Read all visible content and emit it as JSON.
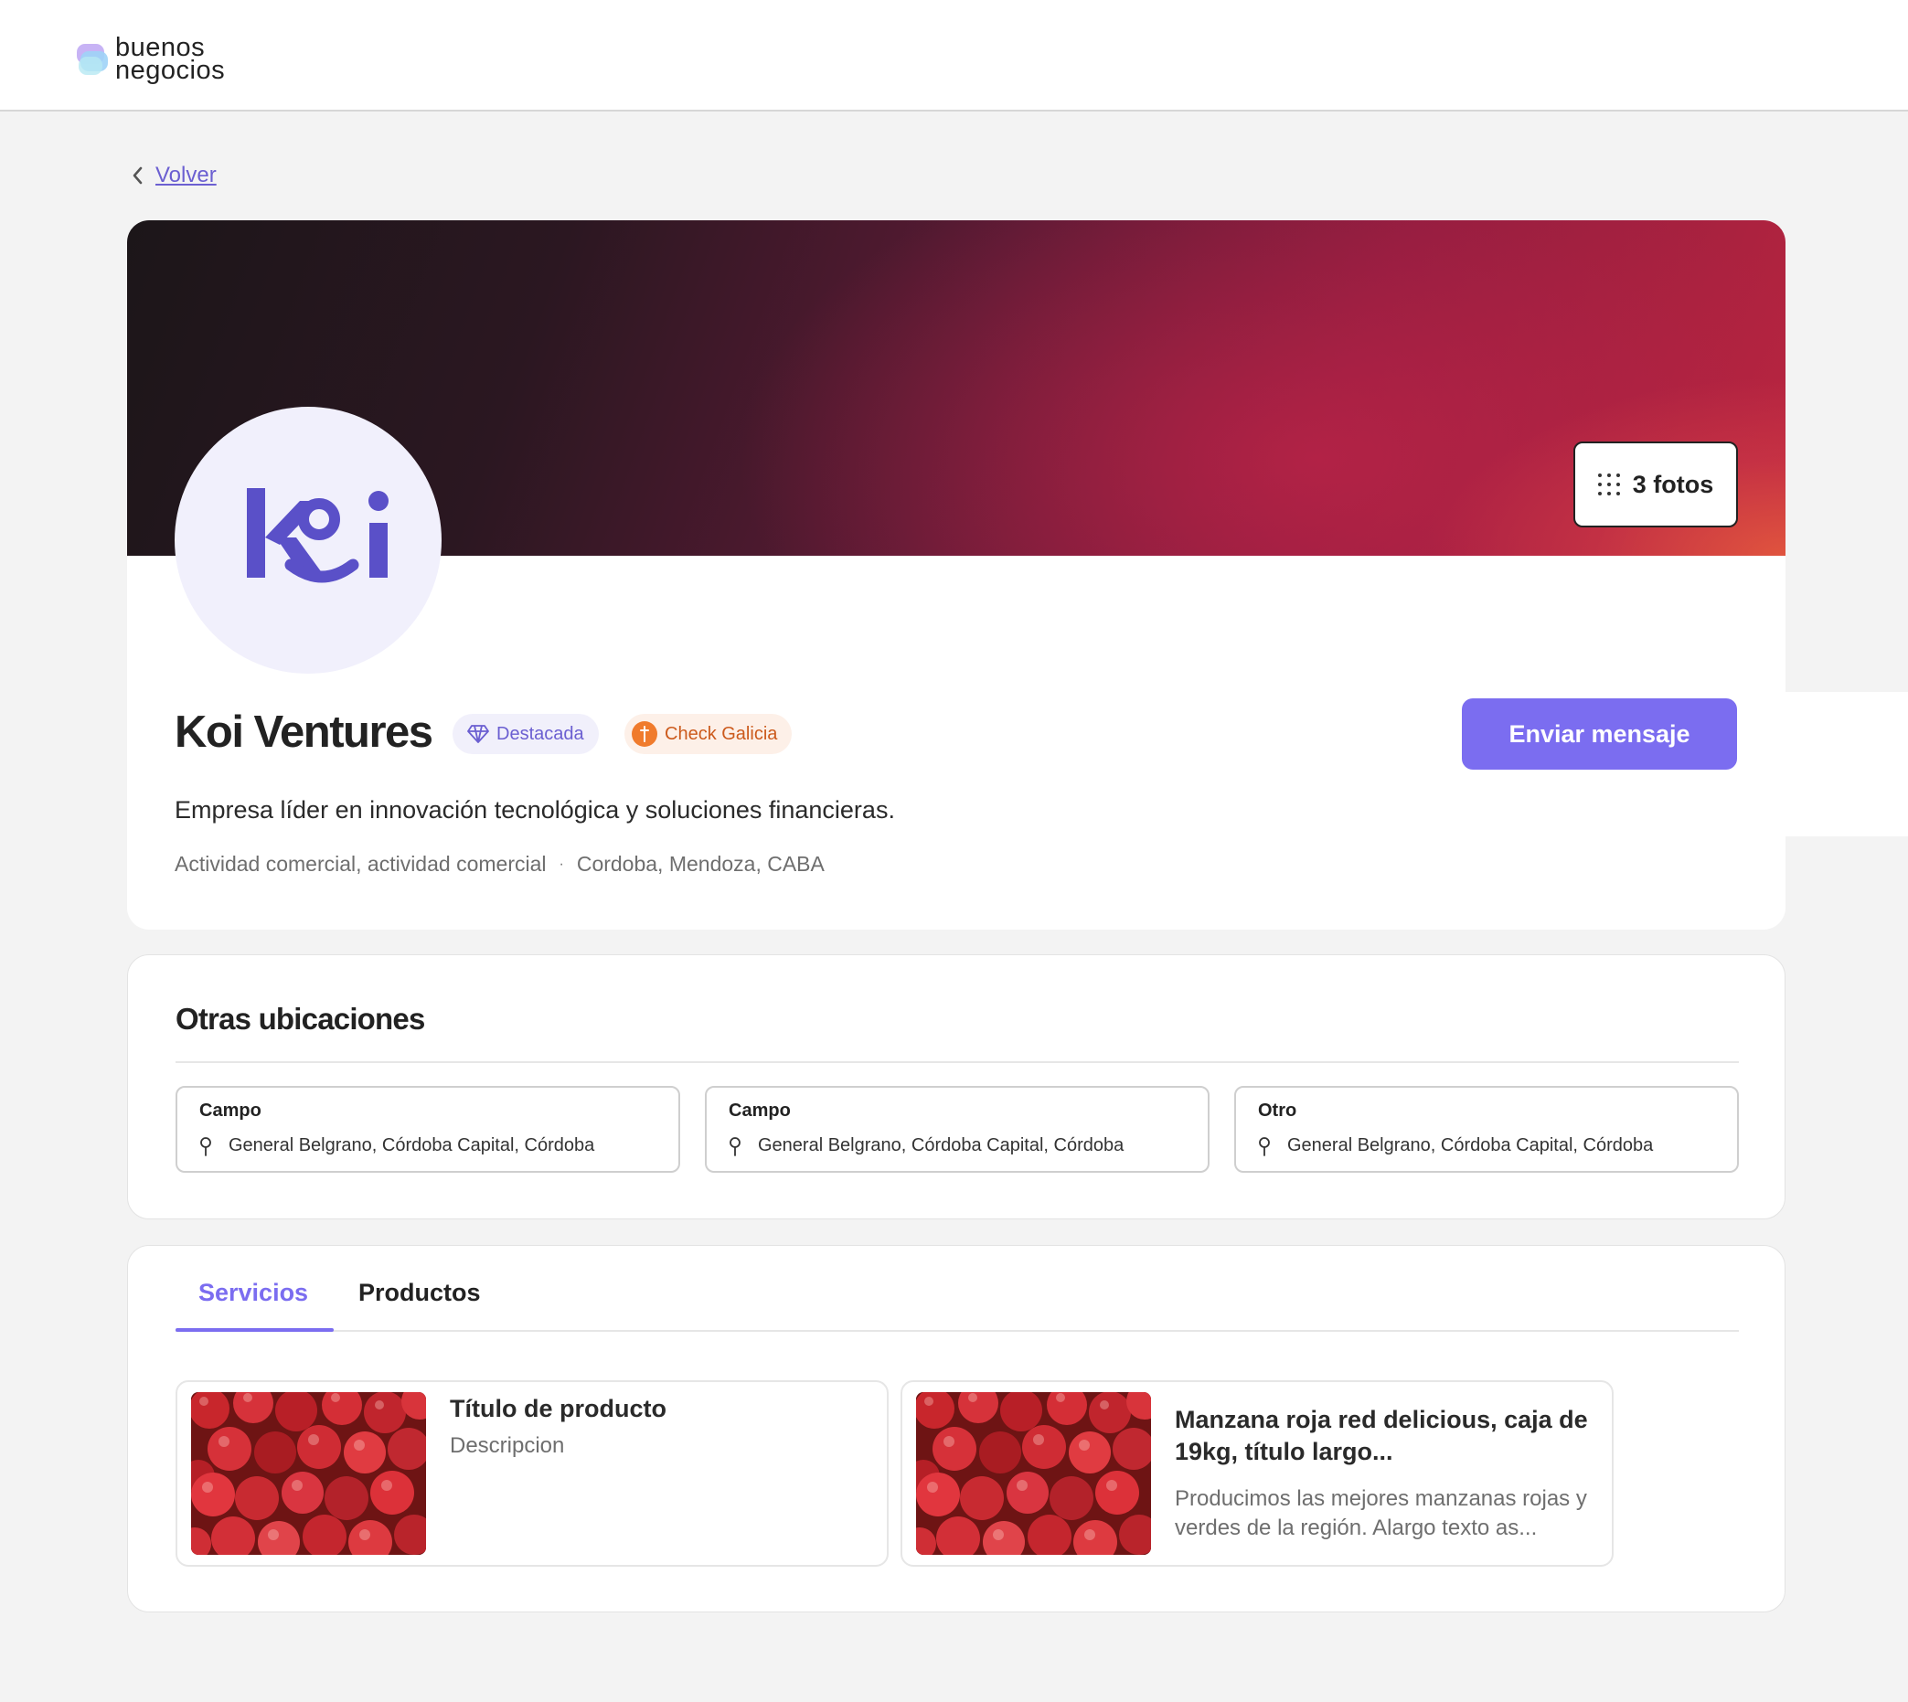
{
  "brand": {
    "logo_line1": "buenos",
    "logo_line2": "negocios"
  },
  "nav": {
    "back_label": "Volver"
  },
  "profile": {
    "photos_label": "3 fotos",
    "name": "Koi Ventures",
    "badges": [
      {
        "label": "Destacada",
        "icon": "diamond-icon",
        "color": "#6b5fd1"
      },
      {
        "label": "Check Galicia",
        "icon": "galicia-check-icon",
        "color": "#f07b2c"
      }
    ],
    "message_button": "Enviar mensaje",
    "tagline": "Empresa líder en innovación tecnológica y soluciones financieras.",
    "activity": "Actividad comercial, actividad comercial",
    "meta_separator": "·",
    "locations": "Cordoba, Mendoza, CABA",
    "avatar_logo": "koi"
  },
  "other_locations": {
    "title": "Otras ubicaciones",
    "items": [
      {
        "type": "Campo",
        "address": "General Belgrano, Córdoba Capital, Córdoba"
      },
      {
        "type": "Campo",
        "address": "General Belgrano, Córdoba Capital, Córdoba"
      },
      {
        "type": "Otro",
        "address": "General Belgrano, Córdoba Capital, Córdoba"
      }
    ]
  },
  "tabs": {
    "items": [
      {
        "label": "Servicios",
        "active": true
      },
      {
        "label": "Productos",
        "active": false
      }
    ]
  },
  "products": [
    {
      "title": "Título de producto",
      "description": "Descripcion"
    },
    {
      "title": "Manzana roja red delicious, caja de 19kg, título largo...",
      "description": "Producimos las mejores manzanas rojas y verdes de la región. Alargo texto as..."
    }
  ],
  "colors": {
    "accent": "#7b6df0",
    "accent_text": "#6b5fd1",
    "galicia": "#f07b2c"
  }
}
